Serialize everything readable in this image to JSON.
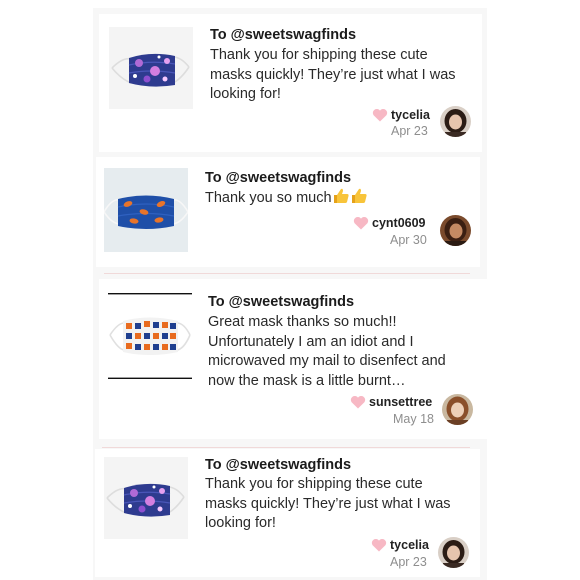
{
  "reviews": [
    {
      "recipient": "To @sweetswagfinds",
      "message_lines": [
        "Thank you for shipping these cute",
        "masks quickly! They’re just what I was",
        "looking for!"
      ],
      "username": "tycelia",
      "date": "Apr 23",
      "thumbnail": "purple-galaxy-mask"
    },
    {
      "recipient": "To @sweetswagfinds",
      "message_lines": [
        "Thank you so much"
      ],
      "emojis": [
        "thumbs-up-icon",
        "thumbs-up-icon"
      ],
      "username": "cynt0609",
      "date": "Apr 30",
      "thumbnail": "blue-orange-football-mask"
    },
    {
      "recipient": "To @sweetswagfinds",
      "message_lines": [
        "Great mask thanks so much!!",
        "Unfortunately I am an idiot and I",
        "microwaved my mail to disenfect and",
        "now the mask is a little burnt…"
      ],
      "username": "sunsettree",
      "date": "May 18",
      "thumbnail": "orange-blue-f-pattern-mask"
    },
    {
      "recipient": "To @sweetswagfinds",
      "message_lines": [
        "Thank you for shipping these cute",
        "masks quickly! They’re just what I was",
        "looking for!"
      ],
      "username": "tycelia",
      "date": "Apr 23",
      "thumbnail": "purple-galaxy-mask"
    }
  ],
  "colors": {
    "heart": "#f7b8c4",
    "date": "#8e8e8e",
    "divider": "#f0d9d9"
  }
}
